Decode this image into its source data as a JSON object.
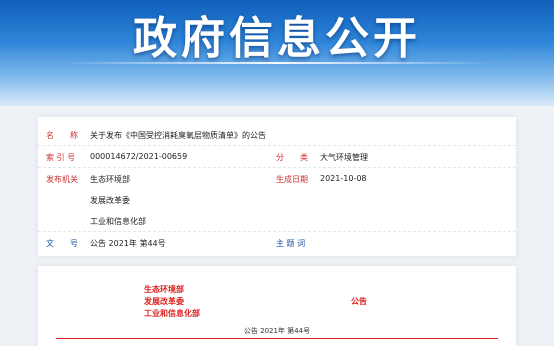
{
  "banner": {
    "title": "政府信息公开"
  },
  "info": {
    "name_label": "名　　称",
    "name_value": "关于发布《中国受控消耗臭氧层物质清单》的公告",
    "index_label": "索 引 号",
    "index_value": "000014672/2021-00659",
    "category_label": "分　　类",
    "category_value": "大气环境管理",
    "issuer_label": "发布机关",
    "issuers": [
      "生态环境部",
      "发展改革委",
      "工业和信息化部"
    ],
    "date_label": "生成日期",
    "date_value": "2021-10-08",
    "docno_label": "文　　号",
    "docno_value": "公告 2021年 第44号",
    "keywords_label": "主 题 词",
    "keywords_value": ""
  },
  "document": {
    "issuers": [
      "生态环境部",
      "发展改革委",
      "工业和信息化部"
    ],
    "type": "公告",
    "number": "公告 2021年 第44号"
  },
  "colors": {
    "label_red": "#cf2f2f",
    "label_blue": "#1a4f9f",
    "heading_red": "#e02020",
    "banner_blue": "#0f5fbb"
  }
}
